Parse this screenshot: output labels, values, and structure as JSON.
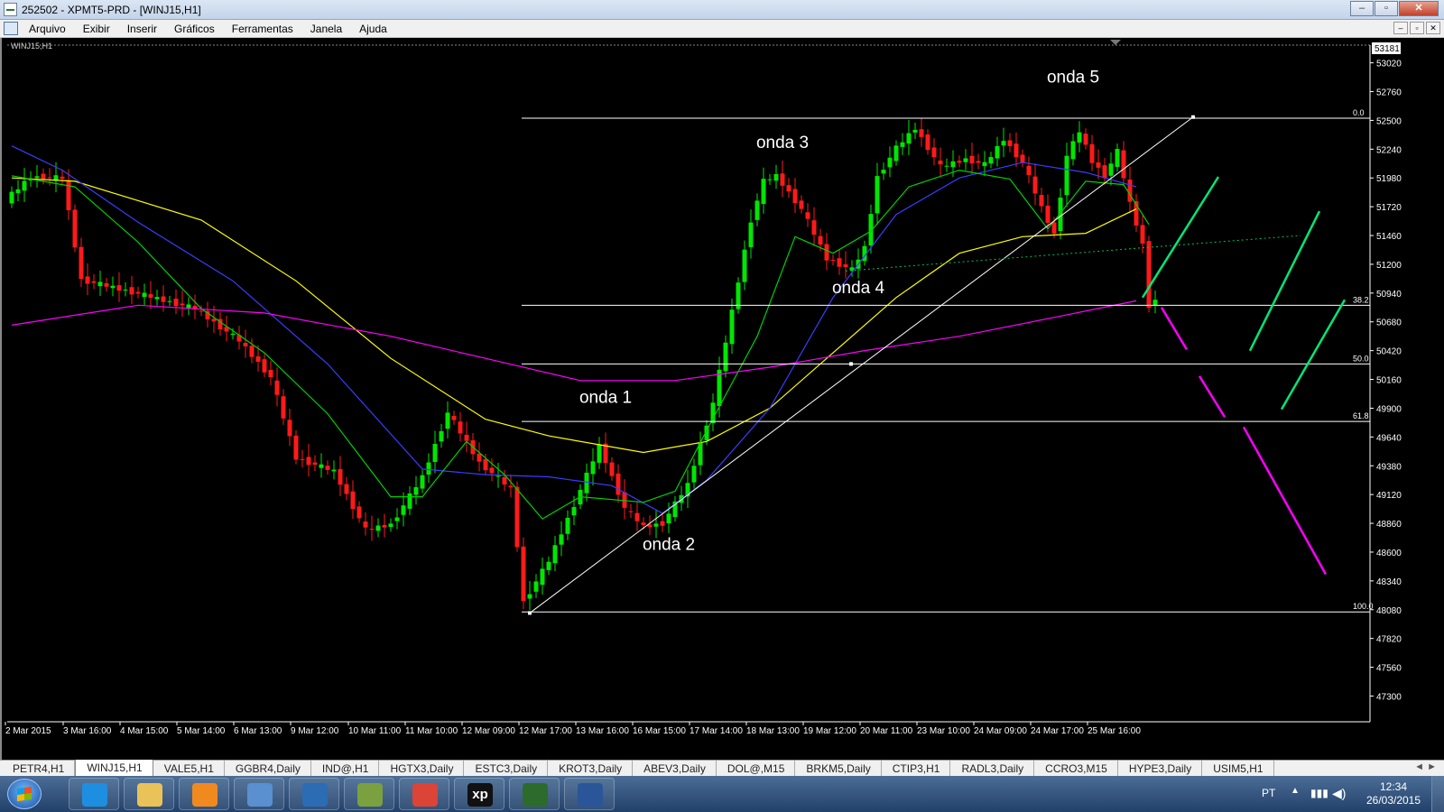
{
  "window": {
    "title": "252502 - XPMT5-PRD - [WINJ15,H1]"
  },
  "menu": [
    "Arquivo",
    "Exibir",
    "Inserir",
    "Gráficos",
    "Ferramentas",
    "Janela",
    "Ajuda"
  ],
  "chart_data": {
    "type": "candlestick",
    "symbol_label": "WINJ15,H1",
    "price_current": "53181",
    "y_ticks": [
      53020,
      52760,
      52500,
      52240,
      51980,
      51720,
      51460,
      51200,
      50940,
      50680,
      50420,
      50160,
      49900,
      49640,
      49380,
      49120,
      48860,
      48600,
      48340,
      48080,
      47820,
      47560,
      47300
    ],
    "ylim": [
      47100,
      53180
    ],
    "x_ticks": [
      "2 Mar 2015",
      "3 Mar 16:00",
      "4 Mar 15:00",
      "5 Mar 14:00",
      "6 Mar 13:00",
      "9 Mar 12:00",
      "10 Mar 11:00",
      "11 Mar 10:00",
      "12 Mar 09:00",
      "12 Mar 17:00",
      "13 Mar 16:00",
      "16 Mar 15:00",
      "17 Mar 14:00",
      "18 Mar 13:00",
      "19 Mar 12:00",
      "20 Mar 11:00",
      "23 Mar 10:00",
      "24 Mar 09:00",
      "24 Mar 17:00",
      "25 Mar 16:00"
    ],
    "fib_levels": [
      {
        "label": "0.0",
        "price": 52520
      },
      {
        "label": "38.2",
        "price": 50830
      },
      {
        "label": "50.0",
        "price": 50300
      },
      {
        "label": "61.8",
        "price": 49780
      },
      {
        "label": "100.0",
        "price": 48060
      }
    ],
    "wave_labels": [
      {
        "text": "onda 1",
        "price": 49950,
        "bar": 94
      },
      {
        "text": "onda 2",
        "price": 48620,
        "bar": 104
      },
      {
        "text": "onda 3",
        "price": 52250,
        "bar": 122
      },
      {
        "text": "onda 4",
        "price": 50940,
        "bar": 134
      },
      {
        "text": "onda 5",
        "price": 52840,
        "bar": 168
      }
    ],
    "trendline": {
      "from": {
        "bar": 82,
        "price": 48050
      },
      "to": {
        "bar": 187,
        "price": 52530
      }
    },
    "dotted_line": {
      "from": {
        "bar": 132,
        "price": 51140
      },
      "to": {
        "bar": 204,
        "price": 51460
      },
      "color": "#00c060"
    },
    "projections": [
      {
        "color": "#00e676",
        "from": {
          "bar": 179,
          "price": 50900
        },
        "to": {
          "bar": 191,
          "price": 51990
        }
      },
      {
        "color": "#00e676",
        "from": {
          "bar": 196,
          "price": 50420
        },
        "to": {
          "bar": 207,
          "price": 51680
        }
      },
      {
        "color": "#00e676",
        "from": {
          "bar": 201,
          "price": 49890
        },
        "to": {
          "bar": 211,
          "price": 50880
        }
      },
      {
        "color": "#ff00ff",
        "from": {
          "bar": 182,
          "price": 50810
        },
        "to": {
          "bar": 186,
          "price": 50430
        }
      },
      {
        "color": "#ff00ff",
        "from": {
          "bar": 188,
          "price": 50190
        },
        "to": {
          "bar": 192,
          "price": 49820
        }
      },
      {
        "color": "#ff00ff",
        "from": {
          "bar": 195,
          "price": 49730
        },
        "to": {
          "bar": 208,
          "price": 48400
        }
      }
    ],
    "moving_averages": [
      {
        "color": "#ffff00",
        "knots": [
          [
            0,
            51980
          ],
          [
            10,
            51950
          ],
          [
            30,
            51600
          ],
          [
            45,
            51050
          ],
          [
            60,
            50350
          ],
          [
            75,
            49800
          ],
          [
            85,
            49650
          ],
          [
            100,
            49500
          ],
          [
            110,
            49600
          ],
          [
            120,
            49900
          ],
          [
            130,
            50400
          ],
          [
            140,
            50900
          ],
          [
            150,
            51300
          ],
          [
            160,
            51450
          ],
          [
            170,
            51480
          ],
          [
            178,
            51700
          ]
        ]
      },
      {
        "color": "#3c3cff",
        "knots": [
          [
            0,
            52270
          ],
          [
            8,
            52050
          ],
          [
            20,
            51580
          ],
          [
            35,
            51050
          ],
          [
            50,
            50300
          ],
          [
            65,
            49350
          ],
          [
            75,
            49300
          ],
          [
            85,
            49280
          ],
          [
            95,
            49200
          ],
          [
            103,
            48950
          ],
          [
            110,
            49250
          ],
          [
            120,
            49900
          ],
          [
            130,
            50900
          ],
          [
            140,
            51650
          ],
          [
            150,
            51980
          ],
          [
            160,
            52120
          ],
          [
            170,
            52030
          ],
          [
            178,
            51900
          ]
        ]
      },
      {
        "color": "#00d000",
        "knots": [
          [
            0,
            52000
          ],
          [
            10,
            51900
          ],
          [
            20,
            51400
          ],
          [
            30,
            50800
          ],
          [
            40,
            50400
          ],
          [
            50,
            49850
          ],
          [
            60,
            49100
          ],
          [
            65,
            49100
          ],
          [
            72,
            49600
          ],
          [
            78,
            49300
          ],
          [
            84,
            48900
          ],
          [
            90,
            49100
          ],
          [
            100,
            49050
          ],
          [
            105,
            49150
          ],
          [
            110,
            49700
          ],
          [
            118,
            50550
          ],
          [
            124,
            51450
          ],
          [
            130,
            51300
          ],
          [
            136,
            51500
          ],
          [
            142,
            51900
          ],
          [
            150,
            52050
          ],
          [
            158,
            51970
          ],
          [
            164,
            51520
          ],
          [
            170,
            51950
          ],
          [
            176,
            51920
          ],
          [
            180,
            51560
          ]
        ]
      },
      {
        "color": "#ff00ff",
        "knots": [
          [
            0,
            50650
          ],
          [
            20,
            50830
          ],
          [
            40,
            50760
          ],
          [
            60,
            50550
          ],
          [
            75,
            50350
          ],
          [
            90,
            50150
          ],
          [
            105,
            50150
          ],
          [
            120,
            50270
          ],
          [
            135,
            50420
          ],
          [
            150,
            50550
          ],
          [
            165,
            50720
          ],
          [
            178,
            50870
          ]
        ]
      }
    ]
  },
  "tabs": [
    "PETR4,H1",
    "WINJ15,H1",
    "VALE5,H1",
    "GGBR4,Daily",
    "IND@,H1",
    "HGTX3,Daily",
    "ESTC3,Daily",
    "KROT3,Daily",
    "ABEV3,Daily",
    "DOL@,M15",
    "BRKM5,Daily",
    "CTIP3,H1",
    "RADL3,Daily",
    "CCRO3,M15",
    "HYPE3,Daily",
    "USIM5,H1"
  ],
  "active_tab": "WINJ15,H1",
  "taskbar": {
    "apps": [
      {
        "name": "internet-explorer",
        "color": "#1e8fe0"
      },
      {
        "name": "folder",
        "color": "#e9c259"
      },
      {
        "name": "media-player",
        "color": "#f08a1e"
      },
      {
        "name": "arrow-app",
        "color": "#5a8fd0"
      },
      {
        "name": "hp",
        "color": "#2b6cb5"
      },
      {
        "name": "tool-app",
        "color": "#7aa040"
      },
      {
        "name": "chrome",
        "color": "#db4437"
      },
      {
        "name": "xp",
        "color": "#111111"
      },
      {
        "name": "metatrader",
        "color": "#2d6b2d"
      },
      {
        "name": "word",
        "color": "#2a5699"
      }
    ],
    "lang": "PT",
    "time": "12:34",
    "date": "26/03/2015"
  }
}
